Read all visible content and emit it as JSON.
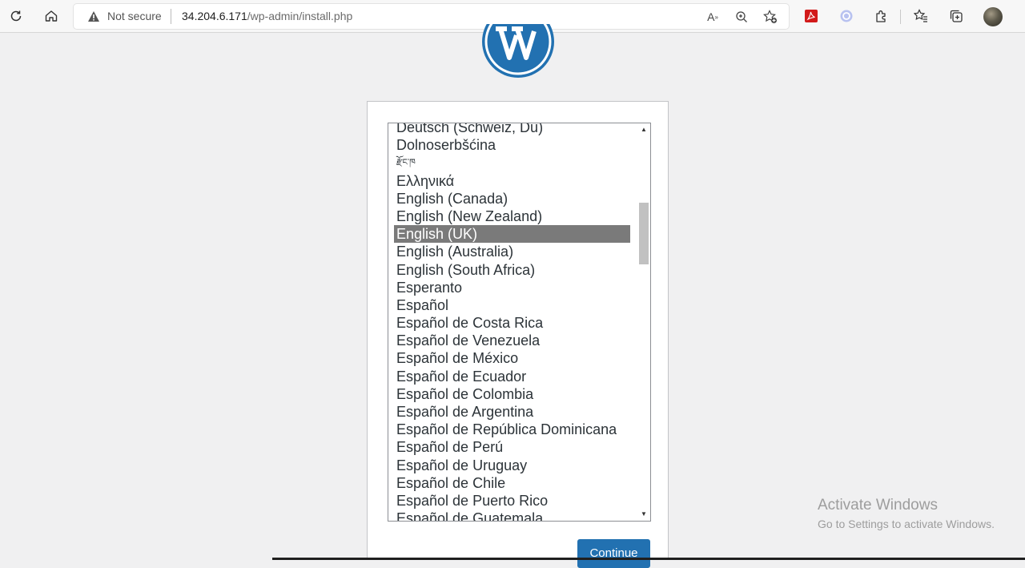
{
  "browser": {
    "security_label": "Not secure",
    "url_host": "34.204.6.171",
    "url_path": "/wp-admin/install.php"
  },
  "language_list": {
    "options": [
      "Deutsch (Schweiz, Du)",
      "Dolnoserbšćina",
      "རྫོང་ཁ",
      "Ελληνικά",
      "English (Canada)",
      "English (New Zealand)",
      "English (UK)",
      "English (Australia)",
      "English (South Africa)",
      "Esperanto",
      "Español",
      "Español de Costa Rica",
      "Español de Venezuela",
      "Español de México",
      "Español de Ecuador",
      "Español de Colombia",
      "Español de Argentina",
      "Español de República Dominicana",
      "Español de Perú",
      "Español de Uruguay",
      "Español de Chile",
      "Español de Puerto Rico",
      "Español de Guatemala"
    ],
    "selected": "English (UK)"
  },
  "continue_label": "Continue",
  "watermark": {
    "title": "Activate Windows",
    "subtitle": "Go to Settings to activate Windows."
  }
}
